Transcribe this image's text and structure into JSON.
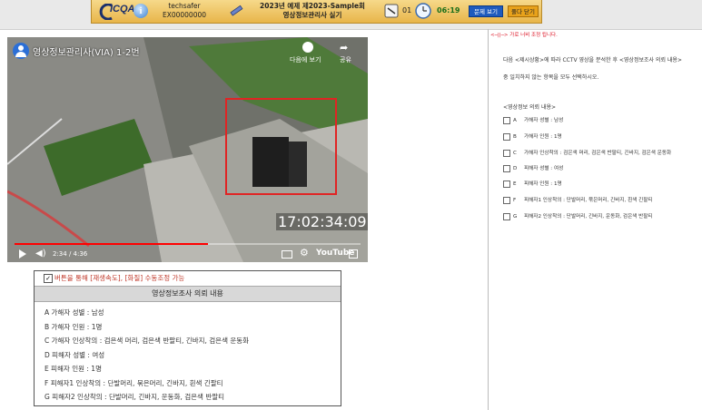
{
  "header": {
    "logo_text": "ICQA",
    "user_name": "techsafer",
    "user_id": "EX00000000",
    "exam_line1": "2023년 예제 제2023-Sample회",
    "exam_line2": "영상정보관리사 실기",
    "question_no": "01",
    "timer": "06:19",
    "btn_view_label": "문제 보기",
    "btn_close_label": "풀다 닫기"
  },
  "video": {
    "channel_title": "영상정보관리사(VIA) 1-2번",
    "watch_later": "다음에 보기",
    "share": "공유",
    "timestamp": "17:02:34:09",
    "time": "2:34 / 4:36",
    "progress": 0.56,
    "brand": "YouTube"
  },
  "infobox": {
    "note": "버튼을 통해 [재생속도], [화질] 수동조정 가능",
    "heading": "영상정보조사 의뢰 내용",
    "items": [
      "A 가해자 성별 : 남성",
      "B 가해자 인원 : 1명",
      "C 가해자 인상착의 : 검은색 머리, 검은색 반팔티, 긴바지, 검은색 운동화",
      "D 피해자 성별 : 여성",
      "E 피해자 인원 : 1명",
      "F 피해자1 인상착의 : 단발머리, 묶은머리, 긴바지, 흰색 긴팔티",
      "G 피해자2 인상착의 : 단발머리, 긴바지, 운동화, 검은색 반팔티"
    ]
  },
  "question": {
    "hint": "<─||─> 가로 너비 조정 됩니다.",
    "text1": "다음 <제시상황>에 따라 CCTV 영상을 분석한 후 <영상정보조사 의뢰 내용>",
    "text2": "중 일치하지 않는 항목을 모두 선택하시오.",
    "heading": "<영상정보 의뢰 내용>",
    "options": [
      {
        "label": "A",
        "text": "가해자 성별 : 남성"
      },
      {
        "label": "B",
        "text": "가해자 인원 : 1명"
      },
      {
        "label": "C",
        "text": "가해자 인상착의 : 검은색 머리, 검은색 반팔티, 긴바지, 검은색 운동화"
      },
      {
        "label": "D",
        "text": "피해자 성별 : 여성"
      },
      {
        "label": "E",
        "text": "피해자 인원 : 1명"
      },
      {
        "label": "F",
        "text": "피해자1 인상착의 : 단발머리, 묶은머리, 긴바지, 흰색 긴팔티"
      },
      {
        "label": "G",
        "text": "피해자2 인상착의 : 단발머리, 긴바지, 운동화, 검은색 반팔티"
      }
    ]
  }
}
